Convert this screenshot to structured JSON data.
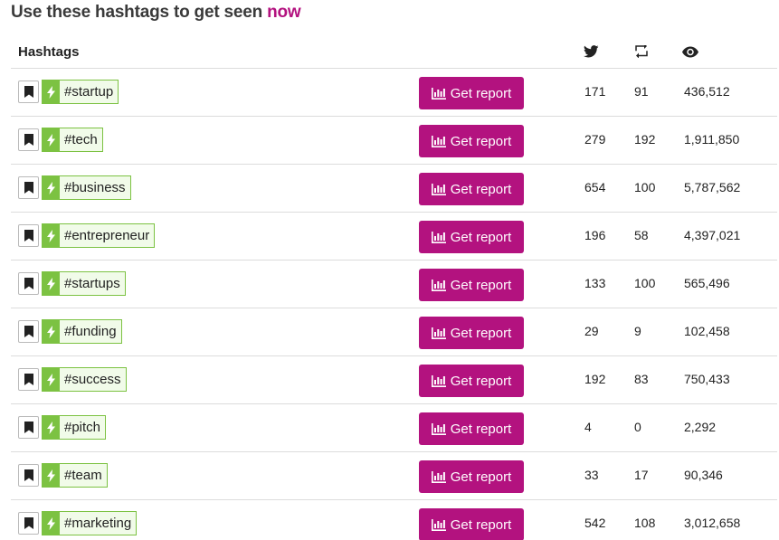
{
  "title": {
    "prefix": "Use these hashtags to get seen ",
    "accent": "now",
    "accent_color": "#b3127f"
  },
  "table": {
    "header_label": "Hashtags",
    "header_icons": [
      "twitter-bird-icon",
      "retweet-icon",
      "eye-icon"
    ],
    "button_label": "Get report",
    "button_icon": "bar-chart-icon",
    "rows": [
      {
        "tag": "#startup",
        "tweets": "171",
        "retweets": "91",
        "views": "436,512"
      },
      {
        "tag": "#tech",
        "tweets": "279",
        "retweets": "192",
        "views": "1,911,850"
      },
      {
        "tag": "#business",
        "tweets": "654",
        "retweets": "100",
        "views": "5,787,562"
      },
      {
        "tag": "#entrepreneur",
        "tweets": "196",
        "retweets": "58",
        "views": "4,397,021"
      },
      {
        "tag": "#startups",
        "tweets": "133",
        "retweets": "100",
        "views": "565,496"
      },
      {
        "tag": "#funding",
        "tweets": "29",
        "retweets": "9",
        "views": "102,458"
      },
      {
        "tag": "#success",
        "tweets": "192",
        "retweets": "83",
        "views": "750,433"
      },
      {
        "tag": "#pitch",
        "tweets": "4",
        "retweets": "0",
        "views": "2,292"
      },
      {
        "tag": "#team",
        "tweets": "33",
        "retweets": "17",
        "views": "90,346"
      },
      {
        "tag": "#marketing",
        "tweets": "542",
        "retweets": "108",
        "views": "3,012,658"
      }
    ]
  },
  "colors": {
    "button": "#b3127f",
    "tag_border": "#7cc242",
    "tag_bg": "#f1fbe9"
  }
}
